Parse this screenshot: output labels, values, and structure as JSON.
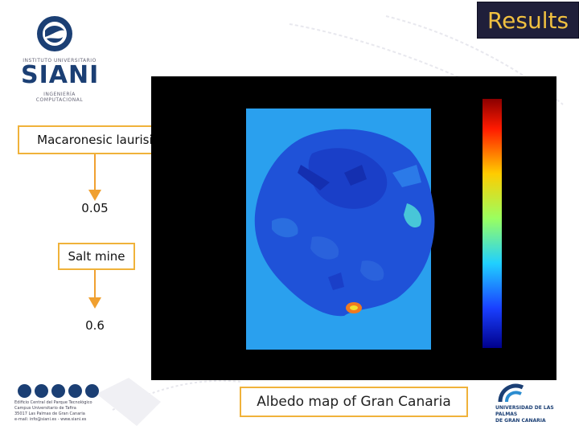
{
  "slide": {
    "title": "Results",
    "logo_top": {
      "institute_line": "INSTITUTO UNIVERSITARIO",
      "name": "SIANI",
      "subline": "INGENIERÍA COMPUTACIONAL"
    },
    "flow": [
      {
        "label": "Macaronesic laurisil",
        "value": "0.05"
      },
      {
        "label": "Salt mine",
        "value": "0.6"
      }
    ],
    "caption": "Albedo map of Gran Canaria",
    "footer_left": {
      "lines": [
        "Edificio Central del Parque Tecnológico",
        "Campus Universitario de Tafira",
        "35017 Las Palmas de Gran Canaria",
        "e-mail: info@siani.es - www.siani.es"
      ]
    },
    "footer_right": {
      "lines": [
        "UNIVERSIDAD DE LAS PALMAS",
        "DE GRAN CANARIA"
      ]
    },
    "colors": {
      "title_bg": "#1f1f3a",
      "title_text": "#f0c040",
      "box_border": "#f0b23a",
      "arrow": "#f0a030",
      "map_background": "#000000",
      "logo_blue": "#1b3f74"
    },
    "icons": {
      "logo_top": "siani-globe-icon",
      "footer_left": "dots-logo-icon",
      "footer_right": "ulpgc-logo-icon",
      "arrow": "arrow-down-icon"
    }
  }
}
